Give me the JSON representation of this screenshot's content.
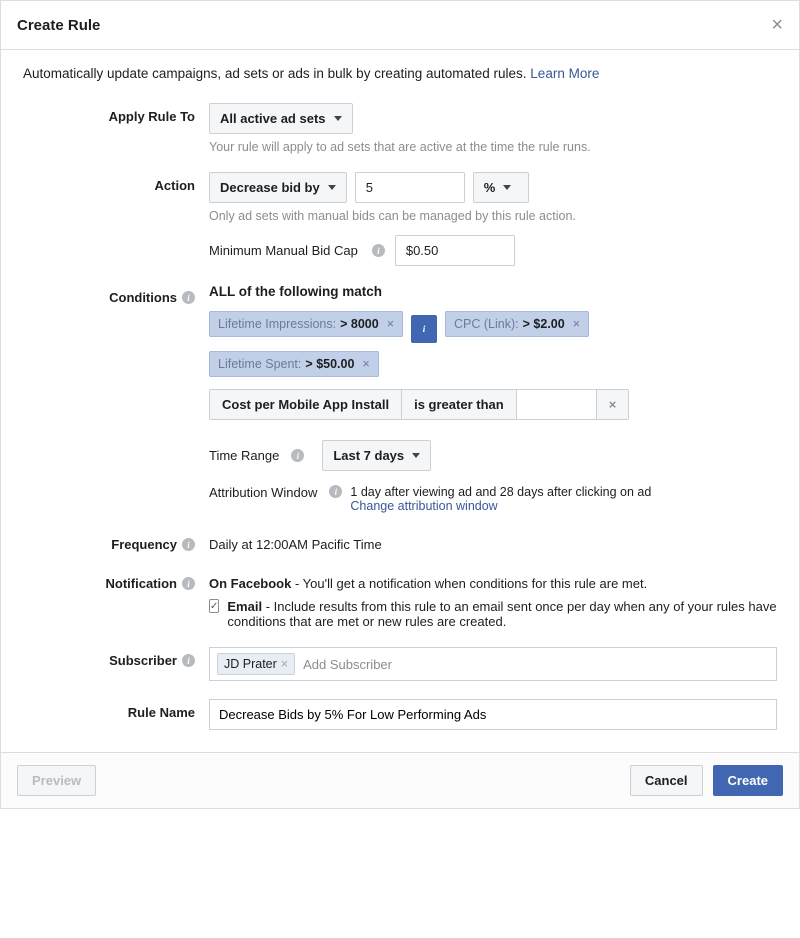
{
  "header": {
    "title": "Create Rule"
  },
  "intro": {
    "text": "Automatically update campaigns, ad sets or ads in bulk by creating automated rules.",
    "learn_more": "Learn More"
  },
  "apply_rule": {
    "label": "Apply Rule To",
    "value": "All active ad sets",
    "helper": "Your rule will apply to ad sets that are active at the time the rule runs."
  },
  "action": {
    "label": "Action",
    "value": "Decrease bid by",
    "amount": "5",
    "unit": "%",
    "helper": "Only ad sets with manual bids can be managed by this rule action.",
    "min_bid_label": "Minimum Manual Bid Cap",
    "min_bid_value": "$0.50"
  },
  "conditions": {
    "label": "Conditions",
    "heading": "ALL of the following match",
    "chips": [
      {
        "metric": "Lifetime Impressions:",
        "op": ">",
        "value": "8000"
      },
      {
        "metric": "CPC (Link):",
        "op": ">",
        "value": "$2.00"
      },
      {
        "metric": "Lifetime Spent:",
        "op": ">",
        "value": "$50.00"
      }
    ],
    "builder": {
      "metric": "Cost per Mobile App Install",
      "op": "is greater than",
      "value": ""
    },
    "time_range": {
      "label": "Time Range",
      "value": "Last 7 days"
    },
    "attribution": {
      "label": "Attribution Window",
      "text": "1 day after viewing ad and 28 days after clicking on ad",
      "change_link": "Change attribution window"
    }
  },
  "frequency": {
    "label": "Frequency",
    "value": "Daily at 12:00AM Pacific Time"
  },
  "notification": {
    "label": "Notification",
    "fb_bold": "On Facebook",
    "fb_text": " - You'll get a notification when conditions for this rule are met.",
    "email_bold": "Email",
    "email_text": " - Include results from this rule to an email sent once per day when any of your rules have conditions that are met or new rules are created."
  },
  "subscriber": {
    "label": "Subscriber",
    "chip": "JD Prater",
    "placeholder": "Add Subscriber"
  },
  "rule_name": {
    "label": "Rule Name",
    "value": "Decrease Bids by 5% For Low Performing Ads"
  },
  "footer": {
    "preview": "Preview",
    "cancel": "Cancel",
    "create": "Create"
  }
}
